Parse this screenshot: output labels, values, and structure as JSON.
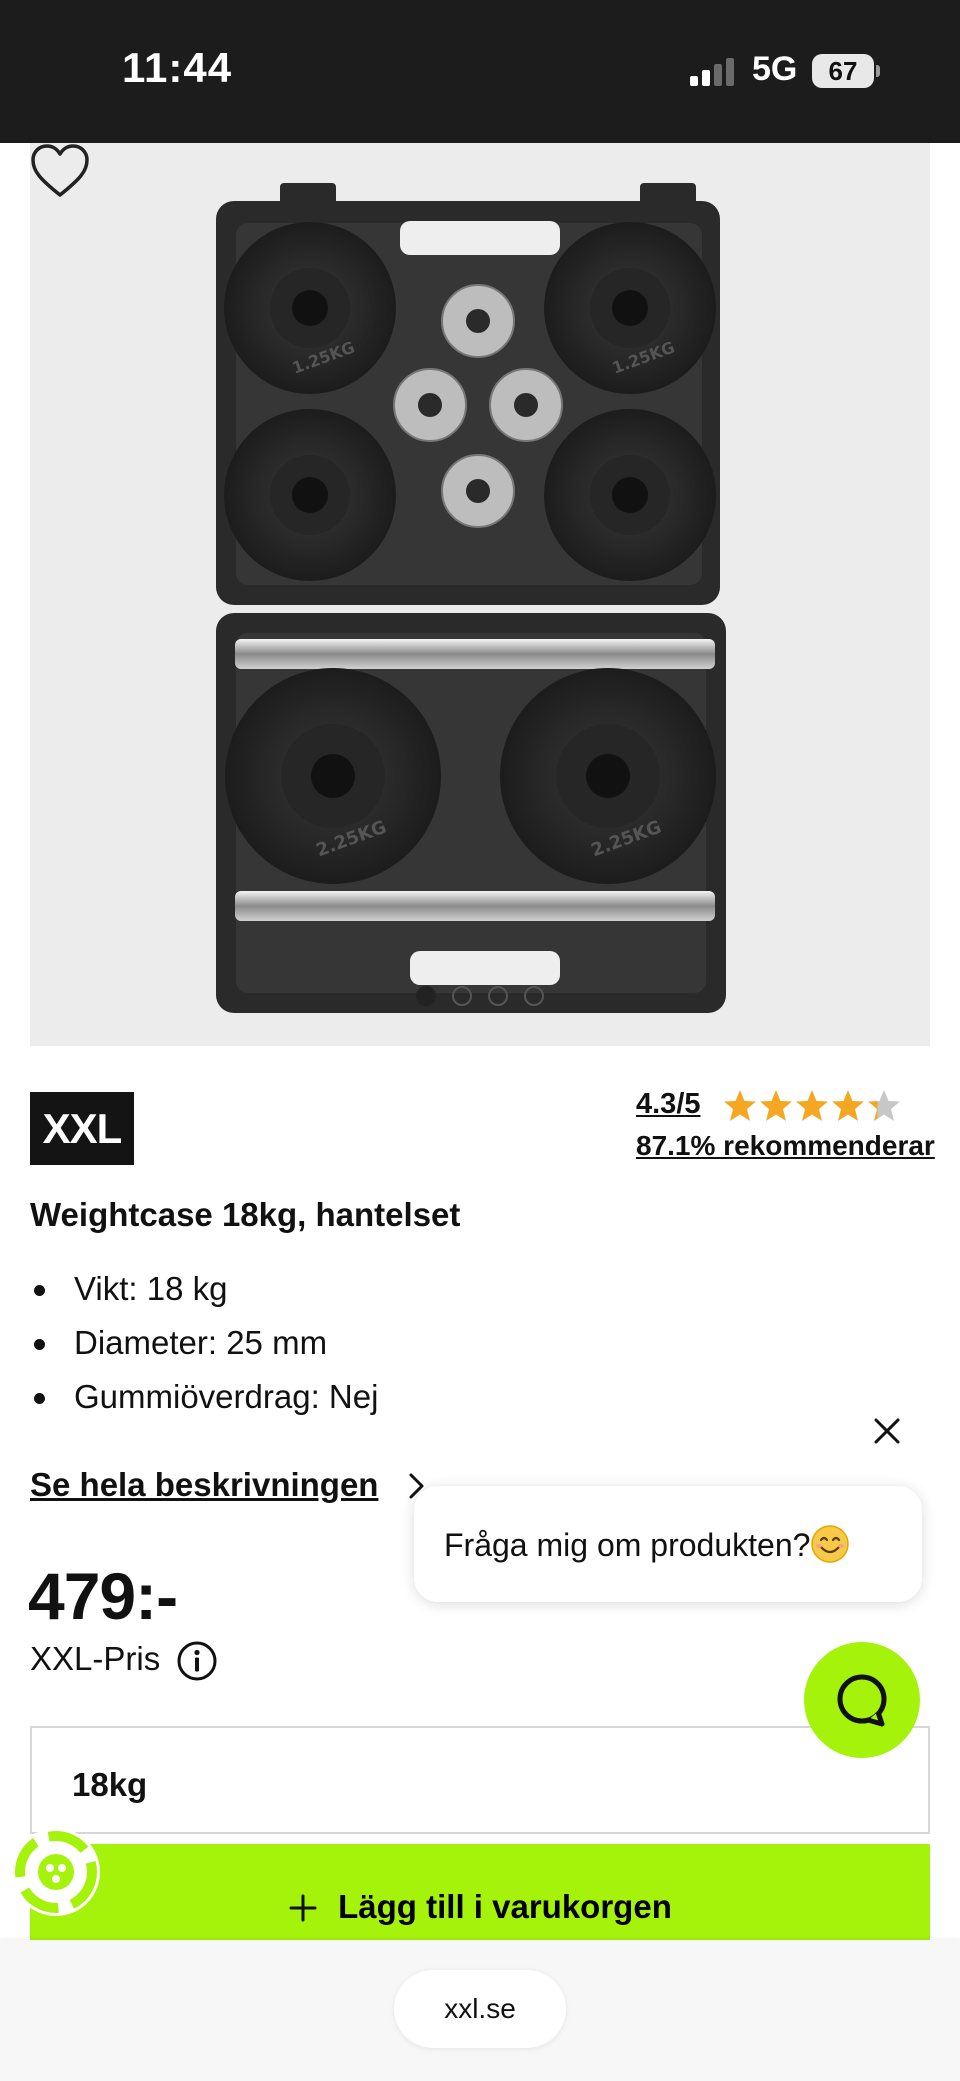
{
  "status_bar": {
    "time": "11:44",
    "network": "5G",
    "battery": "67"
  },
  "product": {
    "brand_logo_text": "XXL",
    "rating_score": "4.3/5",
    "rating_value": 4.3,
    "rating_max": 5,
    "recommend_text": "87.1% rekommenderar",
    "title": "Weightcase 18kg, hantelset",
    "specs": [
      "Vikt: 18 kg",
      "Diameter: 25 mm",
      "Gummiöverdrag: Nej"
    ],
    "description_link": "Se hela beskrivningen",
    "price": "479:-",
    "price_label": "XXL-Pris",
    "variant": "18kg",
    "add_to_cart": "Lägg till i varukorgen",
    "image_count": 4,
    "image_active_index": 0,
    "plate_label_small": "1.25KG",
    "plate_label_large": "2.25KG"
  },
  "chat": {
    "prompt": "Fråga mig om produkten?"
  },
  "browser": {
    "url": "xxl.se"
  },
  "colors": {
    "accent": "#a5f20a",
    "star": "#f5a623",
    "star_empty": "#c7c7c7",
    "status_bar_bg": "#1c1c1c"
  },
  "icons": [
    "signal-icon",
    "heart-icon",
    "star-icon",
    "chevron-right-icon",
    "info-icon",
    "plus-icon",
    "close-icon",
    "chat-icon",
    "smile-emoji-icon",
    "sustainability-badge-icon"
  ]
}
